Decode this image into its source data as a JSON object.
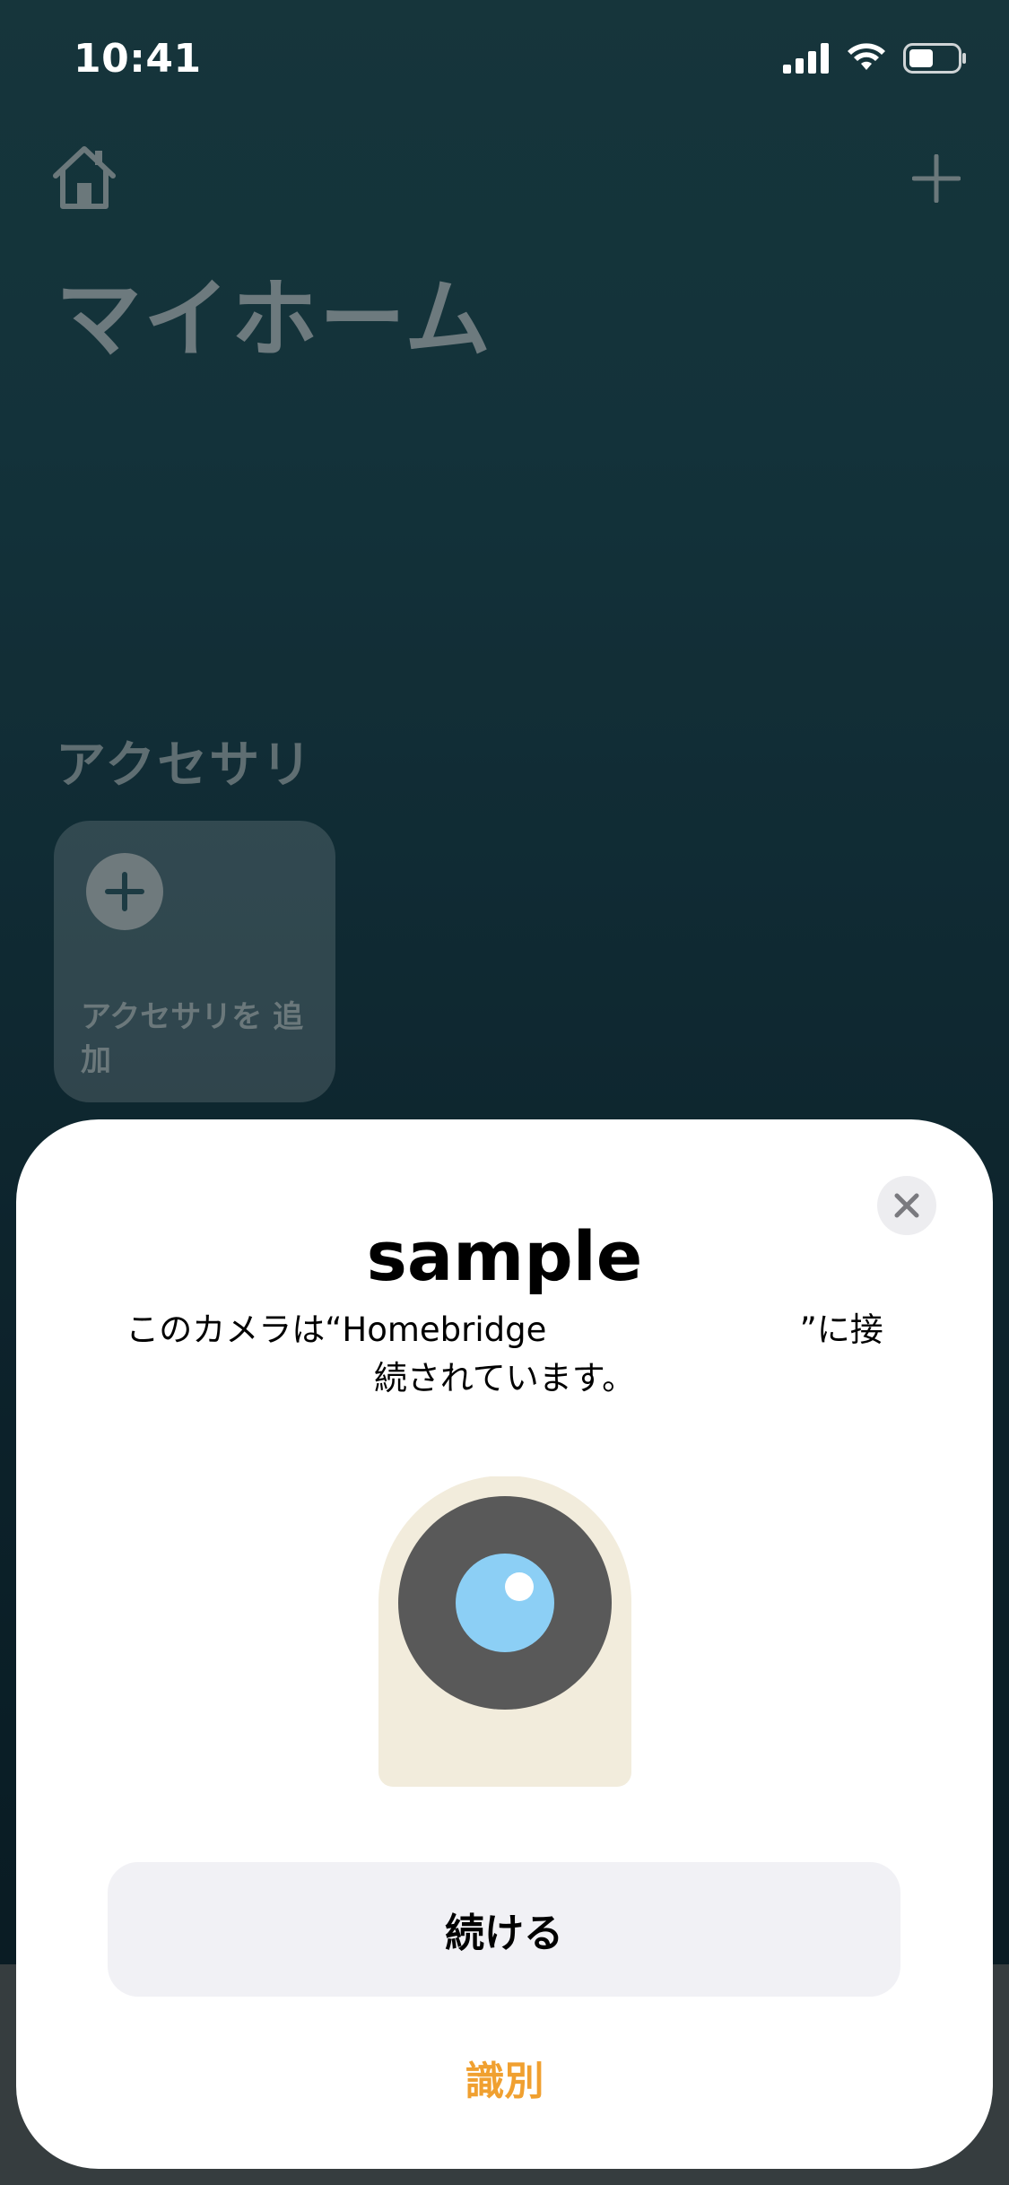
{
  "status_bar": {
    "time": "10:41",
    "icons": [
      "signal-icon",
      "wifi-icon",
      "battery-icon"
    ]
  },
  "home": {
    "title": "マイホーム",
    "section_title": "アクセサリ",
    "add_accessory_label": "アクセサリを 追加",
    "home_icon": "house-icon",
    "add_icon": "plus-icon"
  },
  "sheet": {
    "title": "sample",
    "description": "このカメラは“Homebridge                        ”に接続されています。",
    "continue_label": "続ける",
    "identify_label": "識別",
    "close_icon": "close-icon",
    "image_icon": "camera-icon"
  },
  "colors": {
    "accent": "#f0a030",
    "camera_body": "#f2ecdc",
    "camera_ring": "#595959",
    "camera_lens": "#8ccff5"
  }
}
